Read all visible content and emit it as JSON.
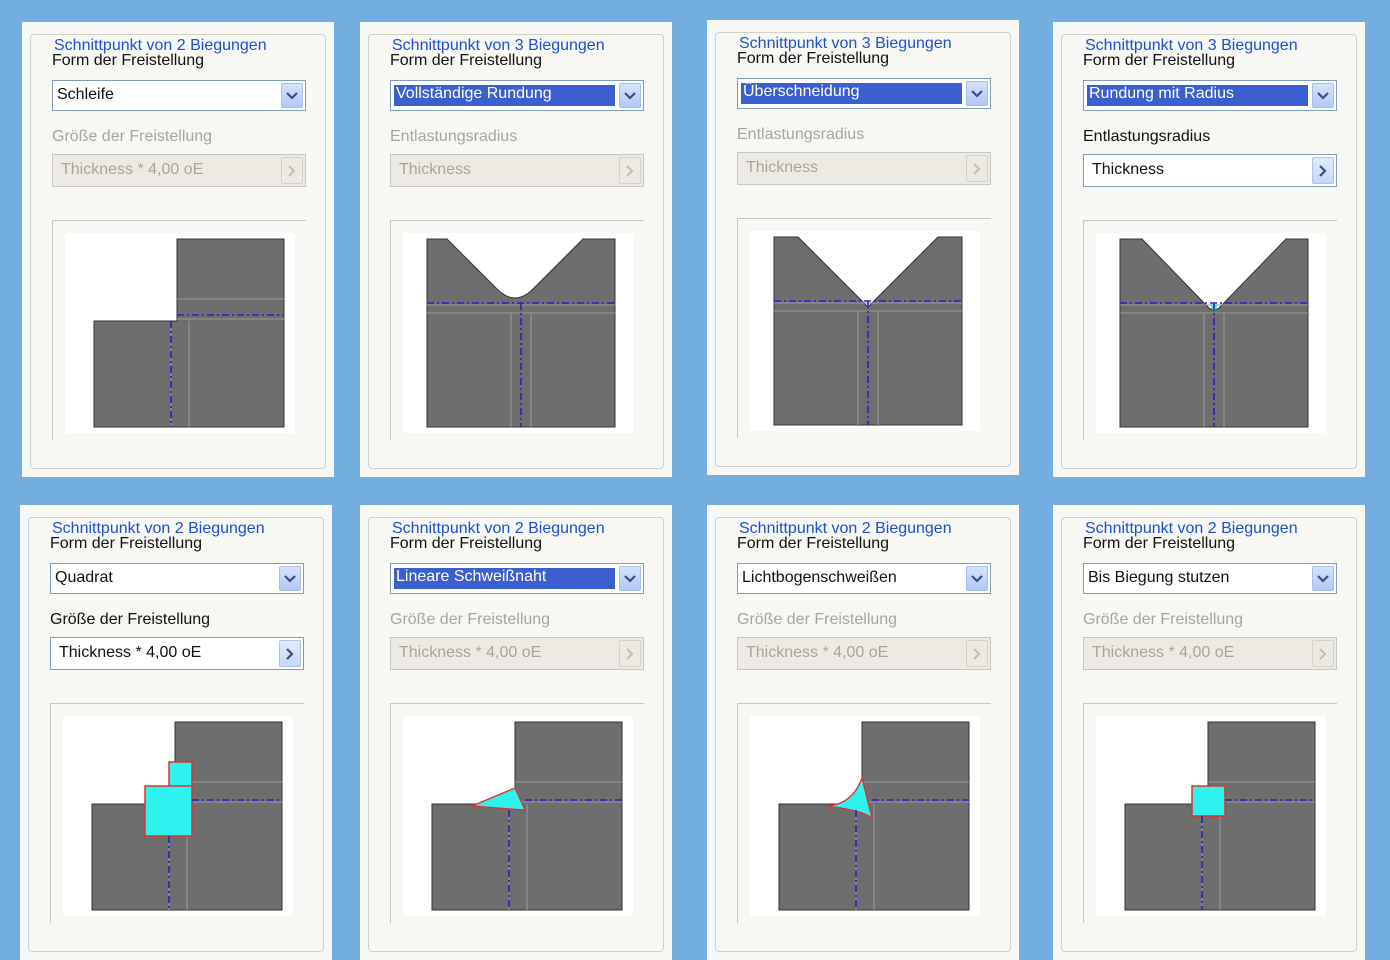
{
  "panels": [
    {
      "legend": "Schnittpunkt von 2 Biegungen",
      "form_label": "Form der Freistellung",
      "shape": "Schleife",
      "size_label": "Größe der Freistellung",
      "size_value": "Thickness * 4,00 oE",
      "size_enabled": false,
      "selected": false
    },
    {
      "legend": "Schnittpunkt von 3 Biegungen",
      "form_label": "Form der Freistellung",
      "shape": "Vollständige Rundung",
      "size_label": "Entlastungsradius",
      "size_value": "Thickness",
      "size_enabled": false,
      "selected": true
    },
    {
      "legend": "Schnittpunkt von 3 Biegungen",
      "form_label": "Form der Freistellung",
      "shape": "Überschneidung",
      "size_label": "Entlastungsradius",
      "size_value": "Thickness",
      "size_enabled": false,
      "selected": true
    },
    {
      "legend": "Schnittpunkt von 3 Biegungen",
      "form_label": "Form der Freistellung",
      "shape": "Rundung mit Radius",
      "size_label": "Entlastungsradius",
      "size_value": "Thickness",
      "size_enabled": true,
      "selected": true
    },
    {
      "legend": "Schnittpunkt von 2 Biegungen",
      "form_label": "Form der Freistellung",
      "shape": "Quadrat",
      "size_label": "Größe der Freistellung",
      "size_value": "Thickness * 4,00 oE",
      "size_enabled": true,
      "selected": false
    },
    {
      "legend": "Schnittpunkt von 2 Biegungen",
      "form_label": "Form der Freistellung",
      "shape": "Lineare Schweißnaht",
      "size_label": "Größe der Freistellung",
      "size_value": "Thickness * 4,00 oE",
      "size_enabled": false,
      "selected": true
    },
    {
      "legend": "Schnittpunkt von 2 Biegungen",
      "form_label": "Form der Freistellung",
      "shape": "Lichtbogenschweißen",
      "size_label": "Größe der Freistellung",
      "size_value": "Thickness * 4,00 oE",
      "size_enabled": false,
      "selected": false
    },
    {
      "legend": "Schnittpunkt von 2 Biegungen",
      "form_label": "Form der Freistellung",
      "shape": "Bis Biegung stutzen",
      "size_label": "Größe der Freistellung",
      "size_value": "Thickness * 4,00 oE",
      "size_enabled": false,
      "selected": false
    }
  ],
  "colors": {
    "plate": "#6e6e6e",
    "relief": "#2ef2ee",
    "relief_outline": "#e03030",
    "bend_line": "#2222cc",
    "legend": "#1d4fd0",
    "disabled_text": "#a7a59b"
  },
  "icons": {
    "dropdown": "chevron-down-icon",
    "browse": "chevron-right-icon"
  }
}
